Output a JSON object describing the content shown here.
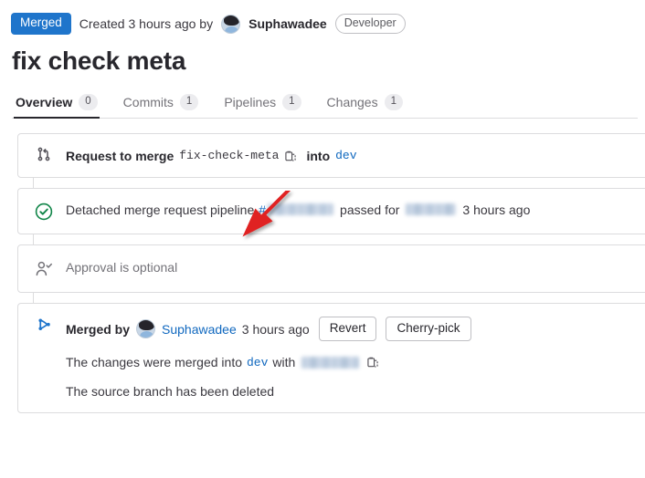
{
  "header": {
    "status_badge": "Merged",
    "created_text": "Created 3 hours ago by",
    "author": "Suphawadee",
    "role_badge": "Developer",
    "avatar_name": "user-avatar"
  },
  "title": "fix check meta",
  "tabs": [
    {
      "label": "Overview",
      "count": "0",
      "active": true
    },
    {
      "label": "Commits",
      "count": "1",
      "active": false
    },
    {
      "label": "Pipelines",
      "count": "1",
      "active": false
    },
    {
      "label": "Changes",
      "count": "1",
      "active": false
    }
  ],
  "merge_request": {
    "prefix": "Request to merge",
    "source_branch": "fix-check-meta",
    "into_label": "into",
    "target_branch": "dev",
    "copy_icon": "copy-icon",
    "branch_icon": "branch-icon"
  },
  "pipeline": {
    "status_icon": "status-success-icon",
    "text_prefix": "Detached merge request pipeline",
    "hash_symbol": "#",
    "pipeline_id_redacted": "",
    "passed_for": "passed for",
    "commit_sha_redacted": "",
    "time": "3 hours ago"
  },
  "approval": {
    "icon": "approval-user-check-icon",
    "text": "Approval is optional"
  },
  "merged": {
    "icon": "merge-icon",
    "prefix": "Merged by",
    "author": "Suphawadee",
    "time": "3 hours ago",
    "revert_label": "Revert",
    "cherry_pick_label": "Cherry-pick",
    "detail_prefix": "The changes were merged into",
    "target_branch": "dev",
    "detail_with": "with",
    "merge_sha_redacted": "",
    "source_branch_deleted": "The source branch has been deleted",
    "copy_icon": "copy-icon"
  },
  "annotation": {
    "arrow_color": "#e02020",
    "arrow_name": "red-arrow-annotation"
  },
  "colors": {
    "merged_badge": "#1f75cb",
    "link": "#1068bf",
    "success": "#108548",
    "border": "#dcdcde"
  }
}
